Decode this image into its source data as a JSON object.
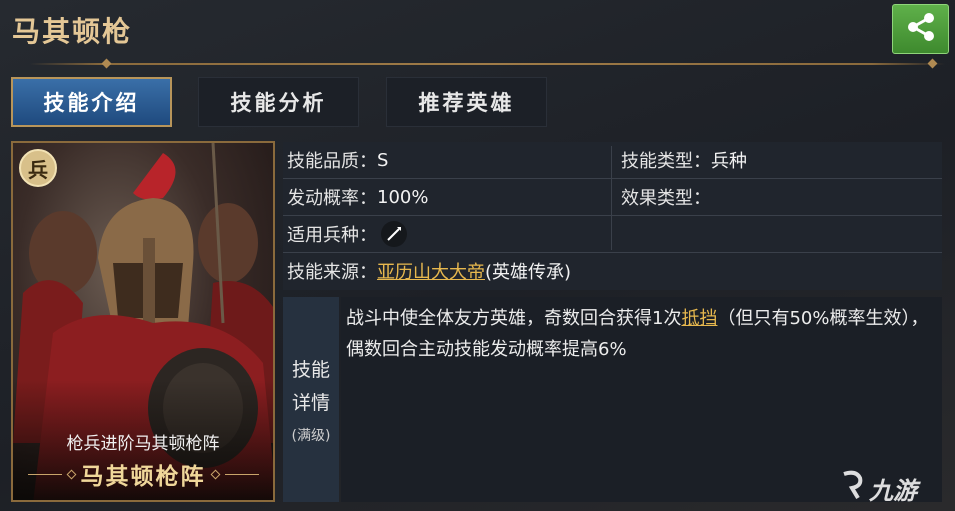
{
  "header": {
    "title": "马其顿枪",
    "share_icon": "share-icon"
  },
  "tabs": [
    {
      "label": "技能介绍",
      "active": true
    },
    {
      "label": "技能分析",
      "active": false
    },
    {
      "label": "推荐英雄",
      "active": false
    }
  ],
  "card": {
    "badge": "兵",
    "subtitle": "枪兵进阶马其顿枪阵",
    "skill_name": "马其顿枪阵"
  },
  "info": {
    "quality_label": "技能品质：",
    "quality_value": "S",
    "type_label": "技能类型：",
    "type_value": "兵种",
    "rate_label": "发动概率：",
    "rate_value": "100%",
    "effect_label": "效果类型：",
    "effect_value": "",
    "troop_label": "适用兵种：",
    "troop_icon": "spear-icon",
    "source_label": "技能来源：",
    "source_link": "亚历山大大帝",
    "source_suffix": "(英雄传承)"
  },
  "detail": {
    "label_line1": "技能",
    "label_line2": "详情",
    "label_line3": "(满级)",
    "text_part1": "战斗中使全体友方英雄，奇数回合获得1次",
    "text_link": "抵挡",
    "text_part2": "（但只有50%概率生效），偶数回合主动技能发动概率提高6%"
  },
  "watermark": {
    "text": "九游"
  },
  "colors": {
    "accent_gold": "#e4c796",
    "link": "#e7b84e",
    "tab_active": "#2f5f96",
    "share_green": "#4f9e3c"
  }
}
